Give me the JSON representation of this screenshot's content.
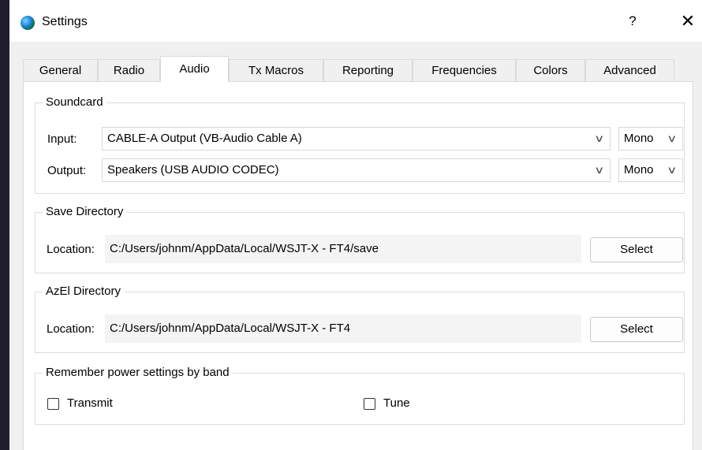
{
  "window": {
    "title": "Settings",
    "help_label": "?",
    "close_label": "✕"
  },
  "tabs": [
    {
      "label": "General"
    },
    {
      "label": "Radio"
    },
    {
      "label": "Audio"
    },
    {
      "label": "Tx Macros"
    },
    {
      "label": "Reporting"
    },
    {
      "label": "Frequencies"
    },
    {
      "label": "Colors"
    },
    {
      "label": "Advanced"
    }
  ],
  "active_tab": "Audio",
  "soundcard": {
    "title": "Soundcard",
    "input_label": "Input:",
    "input_value": "CABLE-A Output (VB-Audio Cable A)",
    "input_channel": "Mono",
    "output_label": "Output:",
    "output_value": "Speakers (USB AUDIO  CODEC)",
    "output_channel": "Mono"
  },
  "save_directory": {
    "title": "Save Directory",
    "location_label": "Location:",
    "location_value": "C:/Users/johnm/AppData/Local/WSJT-X - FT4/save",
    "select_label": "Select"
  },
  "azel_directory": {
    "title": "AzEl Directory",
    "location_label": "Location:",
    "location_value": "C:/Users/johnm/AppData/Local/WSJT-X - FT4",
    "select_label": "Select"
  },
  "power_settings": {
    "title": "Remember power settings by band",
    "transmit_label": "Transmit",
    "transmit_checked": false,
    "tune_label": "Tune",
    "tune_checked": false
  }
}
